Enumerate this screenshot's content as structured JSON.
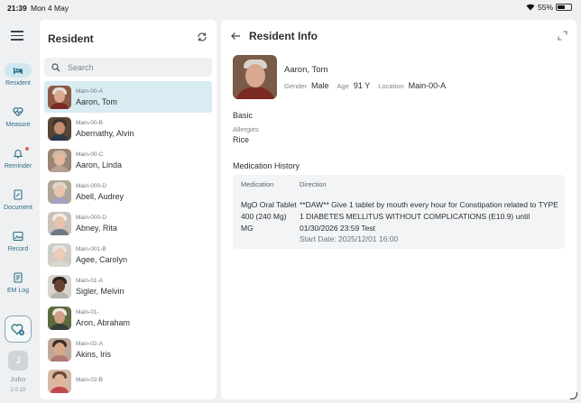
{
  "status_bar": {
    "time": "21:39",
    "date": "Mon 4 May",
    "battery": "55%",
    "battery_level": 0.55
  },
  "rail": {
    "items": [
      {
        "label": "Resident",
        "icon": "bed-icon",
        "active": true
      },
      {
        "label": "Measure",
        "icon": "heart-pulse-icon"
      },
      {
        "label": "Reminder",
        "icon": "bell-icon"
      },
      {
        "label": "Document",
        "icon": "document-icon"
      },
      {
        "label": "Record",
        "icon": "image-icon"
      },
      {
        "label": "EM Log",
        "icon": "log-icon"
      }
    ],
    "avatar_initial": "J",
    "brand": "Jubo",
    "version": "2.0.10"
  },
  "resident_panel": {
    "title": "Resident",
    "search_placeholder": "Search",
    "residents": [
      {
        "location": "Main-00-A",
        "name": "Aaron, Tom"
      },
      {
        "location": "Main-00-B",
        "name": "Abernathy, Alvin"
      },
      {
        "location": "Main-00-C",
        "name": "Aaron, Linda"
      },
      {
        "location": "Main-000-D",
        "name": "Abell, Audrey"
      },
      {
        "location": "Main-000-D",
        "name": "Abney, Rita"
      },
      {
        "location": "Main-001-B",
        "name": "Agee, Carolyn"
      },
      {
        "location": "Main-01-A",
        "name": "Sigler, Melvin"
      },
      {
        "location": "Main-01-",
        "name": "Aron, Abraham"
      },
      {
        "location": "Main-02-A",
        "name": "Akins, Iris"
      },
      {
        "location": "Main-02-B",
        "name": ""
      }
    ]
  },
  "info_panel": {
    "title": "Resident Info",
    "name": "Aaron, Tom",
    "gender_label": "Gender",
    "gender": "Male",
    "age_label": "Age",
    "age": "91 Y",
    "location_label": "Location",
    "location": "Main-00-A",
    "basic_title": "Basic",
    "allergies_label": "Allergies",
    "allergies": "Rice",
    "med_history_title": "Medication History",
    "med_headers": {
      "medication": "Medication",
      "direction": "Direction"
    },
    "medication": {
      "name": "MgO Oral Tablet 400 (240 Mg) MG",
      "direction": "**DAW** Give 1 tablet by mouth every hour for Constipation related to TYPE 1 DIABETES MELLITUS WITHOUT COMPLICATIONS (E10.9) until 01/30/2026 23:59 Test",
      "start": "Start Date: 2025/12/01 16:00"
    }
  },
  "colors": {
    "accent": "#2c6f86",
    "selected_row": "#d8ecf2",
    "background": "#eef0f2"
  }
}
